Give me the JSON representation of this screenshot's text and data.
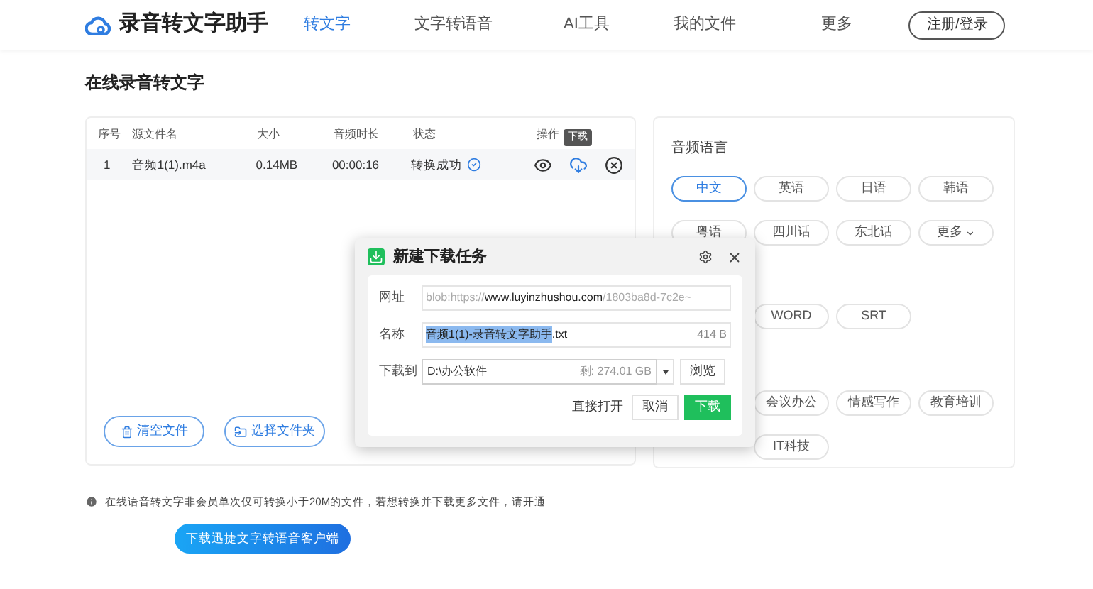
{
  "header": {
    "logo_text": "录音转文字助手",
    "nav": [
      {
        "label": "转文字",
        "selected": true
      },
      {
        "label": "文字转语音",
        "selected": false
      },
      {
        "label": "AI工具",
        "selected": false
      },
      {
        "label": "我的文件",
        "selected": false
      },
      {
        "label": "更多",
        "selected": false
      }
    ],
    "login_button": "注册/登录"
  },
  "page_title": "在线录音转文字",
  "table": {
    "columns": [
      "序号",
      "源文件名",
      "大小",
      "音频时长",
      "状态",
      "操作"
    ],
    "rows": [
      {
        "index": "1",
        "name": "音频1(1).m4a",
        "size": "0.14MB",
        "duration": "00:00:16",
        "status": "转换成功"
      }
    ],
    "tooltip": "下载"
  },
  "left_buttons": [
    {
      "label": "清空文件",
      "kind": "trash"
    },
    {
      "label": "选择文件夹",
      "kind": "folder"
    }
  ],
  "language_panel": {
    "title": "音频语言",
    "languages": [
      {
        "label": "中文",
        "selected": true
      },
      {
        "label": "英语",
        "selected": false
      },
      {
        "label": "日语",
        "selected": false
      },
      {
        "label": "韩语",
        "selected": false
      },
      {
        "label": "粤语",
        "selected": false
      },
      {
        "label": "四川话",
        "selected": false
      },
      {
        "label": "东北话",
        "selected": false
      },
      {
        "label": "更多",
        "selected": false
      }
    ],
    "formats": [
      "WORD",
      "SRT"
    ],
    "scenes": [
      "会议办公",
      "情感写作",
      "教育培训"
    ],
    "scenes_last_row": [
      "IT科技"
    ]
  },
  "notice": "在线语音转文字非会员单次仅可转换小于20M的文件，若想转换并下载更多文件，请开通",
  "client_button": "下载迅捷文字转语音客户端",
  "dialog": {
    "title": "新建下载任务",
    "url": {
      "label": "网址",
      "prefix": "blob:https://",
      "domain": "www.luyinzhushou.com",
      "suffix": "/1803ba8d-7c2e~"
    },
    "name": {
      "label": "名称",
      "highlighted": "音频1(1)-录音转文字助手",
      "rest": ".txt",
      "size": "414 B"
    },
    "save": {
      "label": "下载到",
      "path": "D:\\办公软件",
      "free_space": "剩: 274.01 GB",
      "browse": "浏览"
    },
    "actions": [
      "直接打开",
      "取消",
      "下载"
    ]
  }
}
